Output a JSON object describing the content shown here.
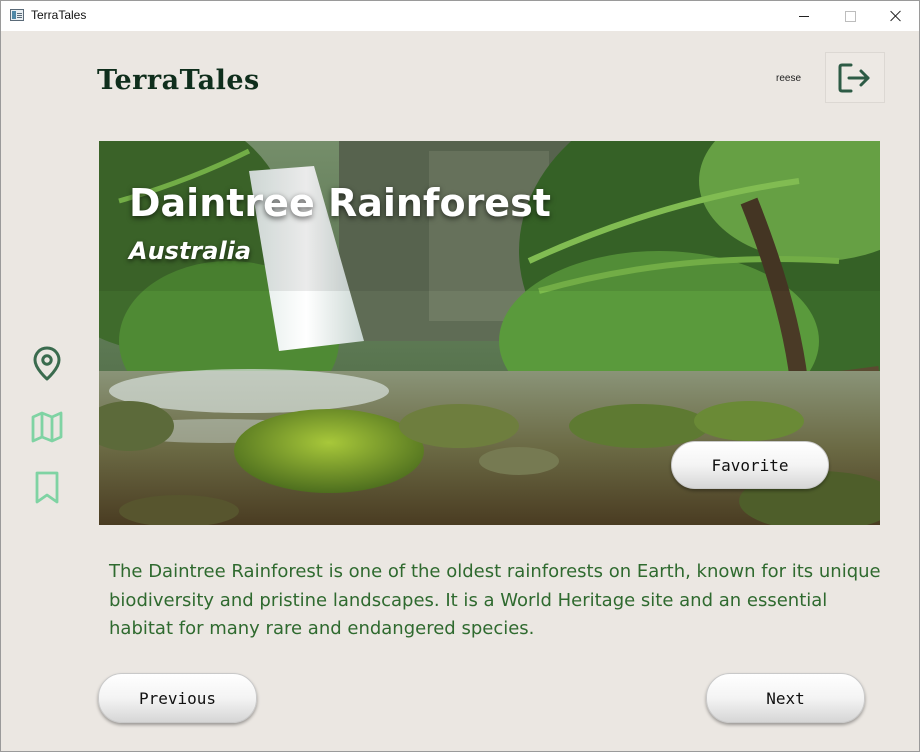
{
  "window": {
    "title": "TerraTales"
  },
  "header": {
    "brand": "TerraTales",
    "username": "reese"
  },
  "icons": {
    "app": "app-icon",
    "logout": "logout-icon",
    "location": "location-pin-icon",
    "map": "map-icon",
    "bookmark": "bookmark-icon"
  },
  "destination": {
    "name": "Daintree Rainforest",
    "country": "Australia",
    "description": "The Daintree Rainforest is one of the oldest rainforests on Earth, known for its unique biodiversity and pristine landscapes. It is a World Heritage site and an essential habitat for many rare and endangered species."
  },
  "buttons": {
    "favorite": "Favorite",
    "previous": "Previous",
    "next": "Next"
  },
  "colors": {
    "background": "#ebe7e2",
    "brand": "#0f2e1c",
    "description_text": "#2f6a2f",
    "nav_icon_active": "#3a6b4e",
    "nav_icon_inactive": "#7fd3a3"
  }
}
